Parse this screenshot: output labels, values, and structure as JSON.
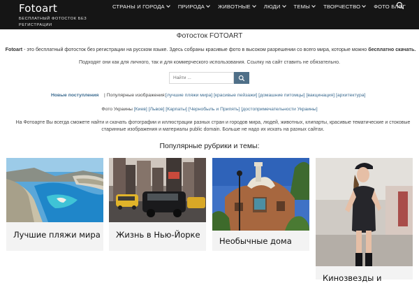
{
  "header": {
    "brand_title": "Fotoart",
    "brand_tagline": "Бесплатный фотосток без регистрации",
    "nav": [
      {
        "label": "СТРАНЫ И ГОРОДА",
        "dropdown": true
      },
      {
        "label": "ПРИРОДА",
        "dropdown": true
      },
      {
        "label": "ЖИВОТНЫЕ",
        "dropdown": true
      },
      {
        "label": "ЛЮДИ",
        "dropdown": true
      },
      {
        "label": "ТЕМЫ",
        "dropdown": true
      },
      {
        "label": "ТВОРЧЕСТВО",
        "dropdown": true
      },
      {
        "label": "ФОТО БЛОГ",
        "dropdown": false
      }
    ],
    "search_icon": "search-icon"
  },
  "page": {
    "title_main": "Фотосток",
    "title_brand": "FOTOART",
    "intro_brand": "Fotoart",
    "intro_text": " - это бесплатный фотосток без регистрации на русском языке. Здесь собраны красивые фото в высоком разрешении со всего мира, которые можно ",
    "intro_bold": "бесплатно скачать.",
    "intro_sub": "Подходят они как для личного, так и для коммерческого использования. Ссылку на сайт ставить не обязательно."
  },
  "search": {
    "placeholder": "Найти ...",
    "button_icon": "search-icon"
  },
  "popular": {
    "new_link": "Новые поступления",
    "label": "| Популярные изображения:",
    "tags": [
      "[лучшие пляжи мира]",
      "[красивые пейзажи]",
      "[домашние питомцы]",
      "[вакцинация]",
      "[архитектура]"
    ]
  },
  "ukraine": {
    "label": "Фото Украины",
    "tags": [
      "[Киев]",
      "[Львов]",
      "[Карпаты]",
      "[Чернобыль и Припять]",
      "[достопримечательности Украины]"
    ]
  },
  "description": {
    "line1": "На Фотоарте Вы всегда сможете найти и скачать фотографии и иллюстрации разных стран и городов мира, людей, животных, клипарты, красивые тематические и стоковые",
    "line2a": "старинные изображения и материалы ",
    "line2_pd": "public domain",
    "line2b": ". Больше не надо их искать на разных сайтах."
  },
  "section": {
    "title": "Популярные рубрики и темы:"
  },
  "cards": [
    {
      "caption": "Лучшие пляжи мира"
    },
    {
      "caption": "Жизнь в Нью-Йорке"
    },
    {
      "caption": "Необычные дома"
    },
    {
      "caption": "Кинозвезды и"
    }
  ],
  "colors": {
    "header_bg": "#151515",
    "link": "#3a6a8f",
    "search_button": "#4f6f88"
  }
}
